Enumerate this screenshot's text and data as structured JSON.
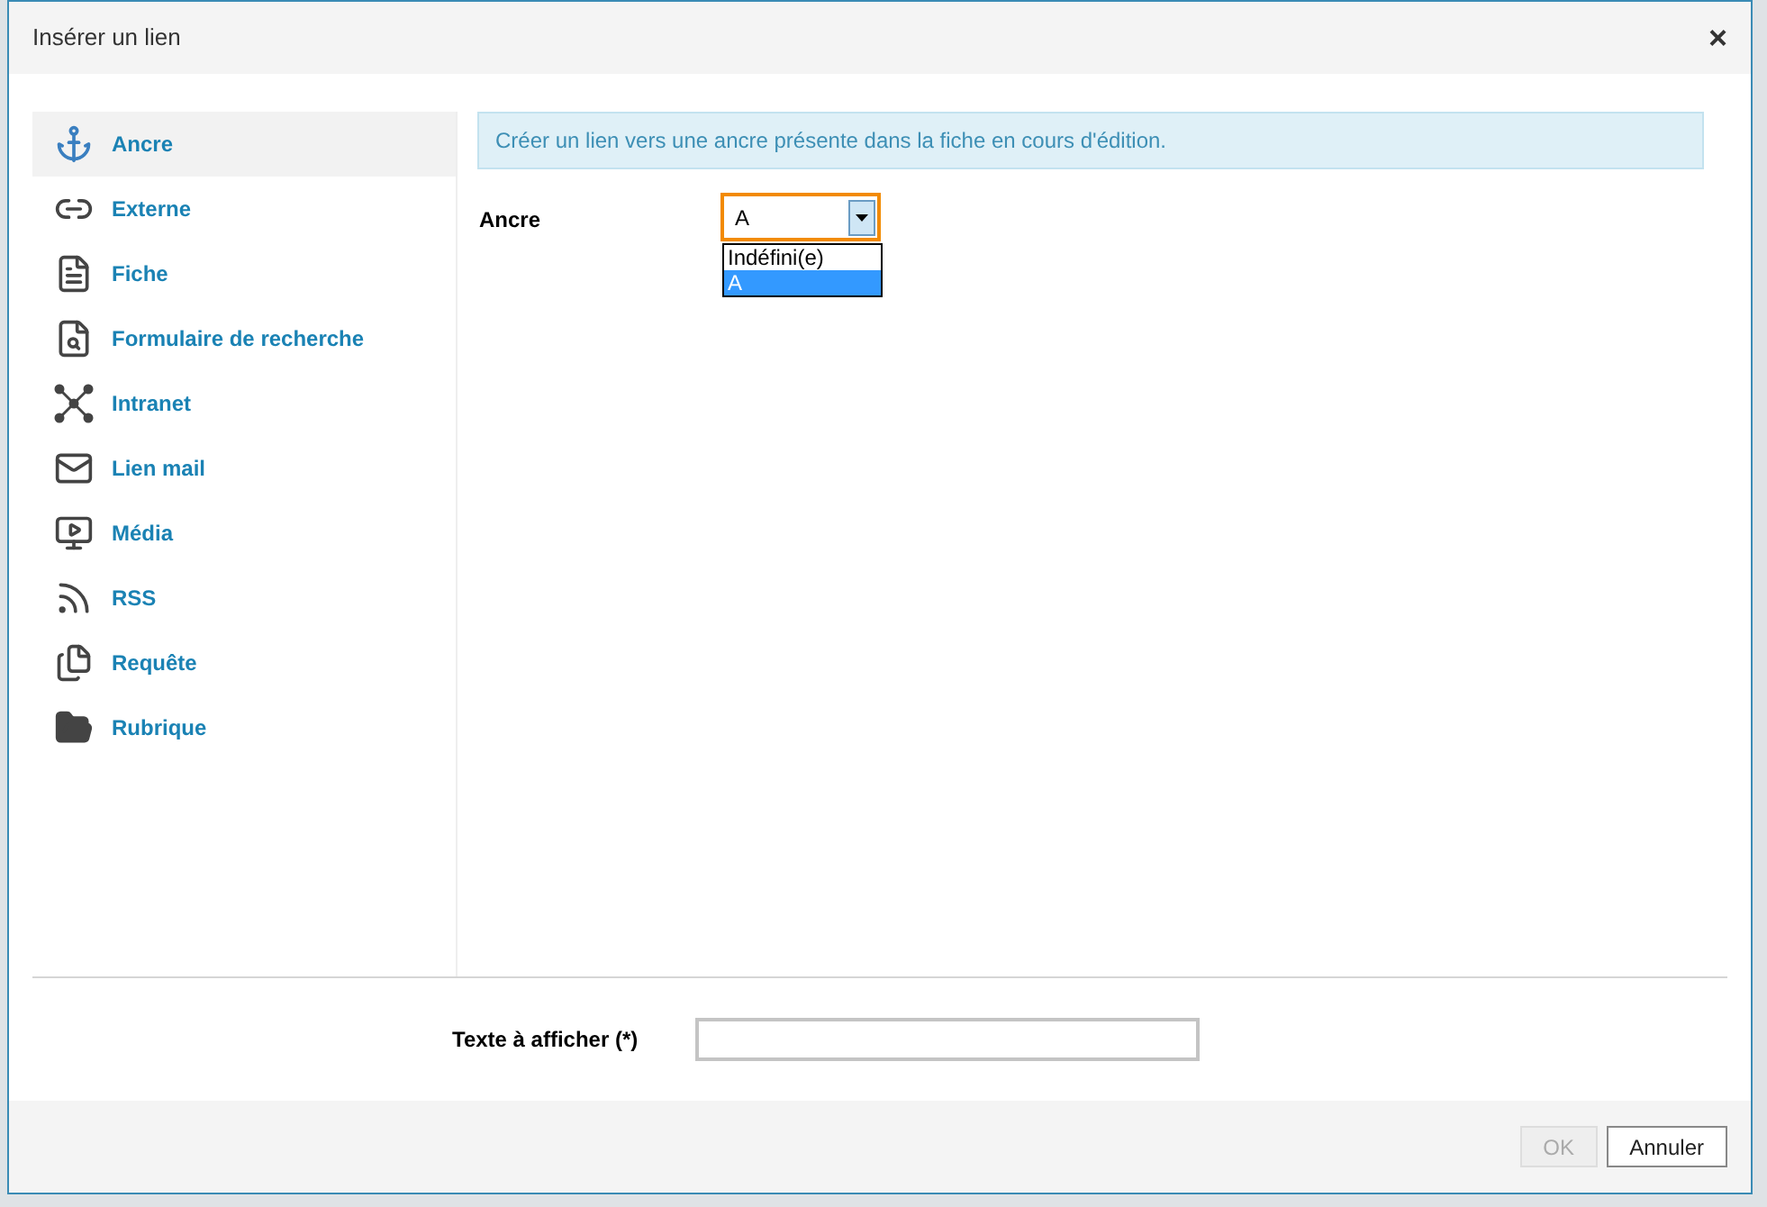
{
  "dialog": {
    "title": "Insérer un lien",
    "close": "×"
  },
  "sidebar": {
    "items": [
      {
        "label": "Ancre",
        "selected": true
      },
      {
        "label": "Externe",
        "selected": false
      },
      {
        "label": "Fiche",
        "selected": false
      },
      {
        "label": "Formulaire de recherche",
        "selected": false
      },
      {
        "label": "Intranet",
        "selected": false
      },
      {
        "label": "Lien mail",
        "selected": false
      },
      {
        "label": "Média",
        "selected": false
      },
      {
        "label": "RSS",
        "selected": false
      },
      {
        "label": "Requête",
        "selected": false
      },
      {
        "label": "Rubrique",
        "selected": false
      }
    ]
  },
  "info": "Créer un lien vers une ancre présente dans la fiche en cours d'édition.",
  "anchor_field": {
    "label": "Ancre",
    "value": "A",
    "expanded": true,
    "options": [
      {
        "label": "Indéfini(e)",
        "selected": false
      },
      {
        "label": "A",
        "selected": true
      }
    ]
  },
  "text_field": {
    "label": "Texte à afficher (*)"
  },
  "buttons": [
    {
      "label": "OK",
      "disabled": true
    },
    {
      "label": "Annuler",
      "disabled": false
    }
  ]
}
